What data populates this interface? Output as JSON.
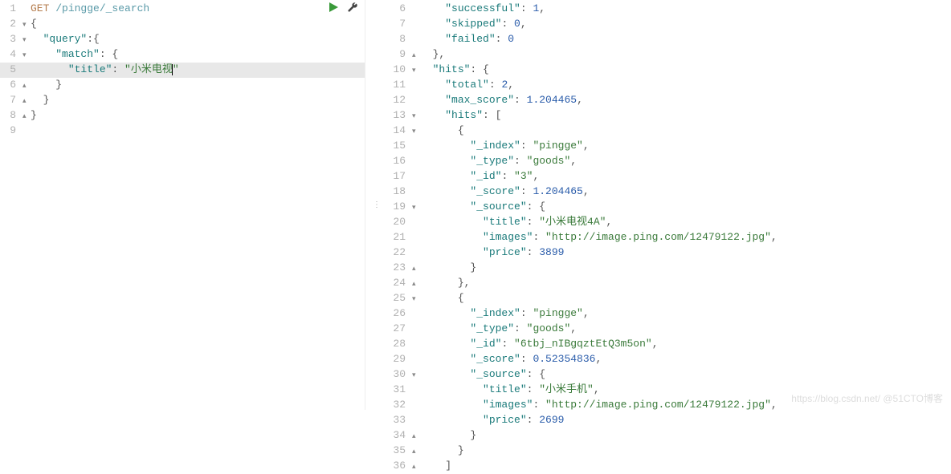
{
  "request": {
    "method": "GET",
    "path": "/pingge/_search",
    "lines": [
      {
        "n": 1,
        "fold": "",
        "indent": "",
        "segs": [
          [
            "kw-method",
            "GET"
          ],
          [
            "",
            ""
          ],
          [
            "path",
            "/pingge/_search"
          ]
        ]
      },
      {
        "n": 2,
        "fold": "▾",
        "indent": "",
        "segs": [
          [
            "punc",
            "{"
          ]
        ]
      },
      {
        "n": 3,
        "fold": "▾",
        "indent": "  ",
        "segs": [
          [
            "key",
            "\"query\""
          ],
          [
            "punc",
            ":{"
          ]
        ]
      },
      {
        "n": 4,
        "fold": "▾",
        "indent": "    ",
        "segs": [
          [
            "key",
            "\"match\""
          ],
          [
            "punc",
            ": {"
          ]
        ]
      },
      {
        "n": 5,
        "fold": "",
        "hl": true,
        "indent": "      ",
        "segs": [
          [
            "key",
            "\"title\""
          ],
          [
            "punc",
            ": "
          ],
          [
            "str",
            "\"小米电视"
          ],
          [
            "cursor",
            ""
          ],
          [
            "str",
            "\""
          ]
        ]
      },
      {
        "n": 6,
        "fold": "▴",
        "indent": "    ",
        "segs": [
          [
            "punc",
            "}"
          ]
        ]
      },
      {
        "n": 7,
        "fold": "▴",
        "indent": "  ",
        "segs": [
          [
            "punc",
            "}"
          ]
        ]
      },
      {
        "n": 8,
        "fold": "▴",
        "indent": "",
        "segs": [
          [
            "punc",
            "}"
          ]
        ]
      },
      {
        "n": 9,
        "fold": "",
        "indent": "",
        "segs": []
      }
    ]
  },
  "response": {
    "lines": [
      {
        "n": 6,
        "fold": "",
        "indent": "    ",
        "segs": [
          [
            "key",
            "\"successful\""
          ],
          [
            "punc",
            ": "
          ],
          [
            "num",
            "1"
          ],
          [
            "punc",
            ","
          ]
        ]
      },
      {
        "n": 7,
        "fold": "",
        "indent": "    ",
        "segs": [
          [
            "key",
            "\"skipped\""
          ],
          [
            "punc",
            ": "
          ],
          [
            "num",
            "0"
          ],
          [
            "punc",
            ","
          ]
        ]
      },
      {
        "n": 8,
        "fold": "",
        "indent": "    ",
        "segs": [
          [
            "key",
            "\"failed\""
          ],
          [
            "punc",
            ": "
          ],
          [
            "num",
            "0"
          ]
        ]
      },
      {
        "n": 9,
        "fold": "▴",
        "indent": "  ",
        "segs": [
          [
            "punc",
            "},"
          ]
        ]
      },
      {
        "n": 10,
        "fold": "▾",
        "indent": "  ",
        "segs": [
          [
            "key",
            "\"hits\""
          ],
          [
            "punc",
            ": {"
          ]
        ]
      },
      {
        "n": 11,
        "fold": "",
        "indent": "    ",
        "segs": [
          [
            "key",
            "\"total\""
          ],
          [
            "punc",
            ": "
          ],
          [
            "num",
            "2"
          ],
          [
            "punc",
            ","
          ]
        ]
      },
      {
        "n": 12,
        "fold": "",
        "indent": "    ",
        "segs": [
          [
            "key",
            "\"max_score\""
          ],
          [
            "punc",
            ": "
          ],
          [
            "num",
            "1.204465"
          ],
          [
            "punc",
            ","
          ]
        ]
      },
      {
        "n": 13,
        "fold": "▾",
        "indent": "    ",
        "segs": [
          [
            "key",
            "\"hits\""
          ],
          [
            "punc",
            ": ["
          ]
        ]
      },
      {
        "n": 14,
        "fold": "▾",
        "indent": "      ",
        "segs": [
          [
            "punc",
            "{"
          ]
        ]
      },
      {
        "n": 15,
        "fold": "",
        "indent": "        ",
        "segs": [
          [
            "key",
            "\"_index\""
          ],
          [
            "punc",
            ": "
          ],
          [
            "str",
            "\"pingge\""
          ],
          [
            "punc",
            ","
          ]
        ]
      },
      {
        "n": 16,
        "fold": "",
        "indent": "        ",
        "segs": [
          [
            "key",
            "\"_type\""
          ],
          [
            "punc",
            ": "
          ],
          [
            "str",
            "\"goods\""
          ],
          [
            "punc",
            ","
          ]
        ]
      },
      {
        "n": 17,
        "fold": "",
        "indent": "        ",
        "segs": [
          [
            "key",
            "\"_id\""
          ],
          [
            "punc",
            ": "
          ],
          [
            "str",
            "\"3\""
          ],
          [
            "punc",
            ","
          ]
        ]
      },
      {
        "n": 18,
        "fold": "",
        "indent": "        ",
        "segs": [
          [
            "key",
            "\"_score\""
          ],
          [
            "punc",
            ": "
          ],
          [
            "num",
            "1.204465"
          ],
          [
            "punc",
            ","
          ]
        ]
      },
      {
        "n": 19,
        "fold": "▾",
        "indent": "        ",
        "segs": [
          [
            "key",
            "\"_source\""
          ],
          [
            "punc",
            ": {"
          ]
        ]
      },
      {
        "n": 20,
        "fold": "",
        "indent": "          ",
        "segs": [
          [
            "key",
            "\"title\""
          ],
          [
            "punc",
            ": "
          ],
          [
            "str",
            "\"小米电视4A\""
          ],
          [
            "punc",
            ","
          ]
        ]
      },
      {
        "n": 21,
        "fold": "",
        "indent": "          ",
        "segs": [
          [
            "key",
            "\"images\""
          ],
          [
            "punc",
            ": "
          ],
          [
            "str",
            "\"http://image.ping.com/12479122.jpg\""
          ],
          [
            "punc",
            ","
          ]
        ]
      },
      {
        "n": 22,
        "fold": "",
        "indent": "          ",
        "segs": [
          [
            "key",
            "\"price\""
          ],
          [
            "punc",
            ": "
          ],
          [
            "num",
            "3899"
          ]
        ]
      },
      {
        "n": 23,
        "fold": "▴",
        "indent": "        ",
        "segs": [
          [
            "punc",
            "}"
          ]
        ]
      },
      {
        "n": 24,
        "fold": "▴",
        "indent": "      ",
        "segs": [
          [
            "punc",
            "},"
          ]
        ]
      },
      {
        "n": 25,
        "fold": "▾",
        "indent": "      ",
        "segs": [
          [
            "punc",
            "{"
          ]
        ]
      },
      {
        "n": 26,
        "fold": "",
        "indent": "        ",
        "segs": [
          [
            "key",
            "\"_index\""
          ],
          [
            "punc",
            ": "
          ],
          [
            "str",
            "\"pingge\""
          ],
          [
            "punc",
            ","
          ]
        ]
      },
      {
        "n": 27,
        "fold": "",
        "indent": "        ",
        "segs": [
          [
            "key",
            "\"_type\""
          ],
          [
            "punc",
            ": "
          ],
          [
            "str",
            "\"goods\""
          ],
          [
            "punc",
            ","
          ]
        ]
      },
      {
        "n": 28,
        "fold": "",
        "indent": "        ",
        "segs": [
          [
            "key",
            "\"_id\""
          ],
          [
            "punc",
            ": "
          ],
          [
            "str",
            "\"6tbj_nIBgqztEtQ3m5on\""
          ],
          [
            "punc",
            ","
          ]
        ]
      },
      {
        "n": 29,
        "fold": "",
        "indent": "        ",
        "segs": [
          [
            "key",
            "\"_score\""
          ],
          [
            "punc",
            ": "
          ],
          [
            "num",
            "0.52354836"
          ],
          [
            "punc",
            ","
          ]
        ]
      },
      {
        "n": 30,
        "fold": "▾",
        "indent": "        ",
        "segs": [
          [
            "key",
            "\"_source\""
          ],
          [
            "punc",
            ": {"
          ]
        ]
      },
      {
        "n": 31,
        "fold": "",
        "indent": "          ",
        "segs": [
          [
            "key",
            "\"title\""
          ],
          [
            "punc",
            ": "
          ],
          [
            "str",
            "\"小米手机\""
          ],
          [
            "punc",
            ","
          ]
        ]
      },
      {
        "n": 32,
        "fold": "",
        "indent": "          ",
        "segs": [
          [
            "key",
            "\"images\""
          ],
          [
            "punc",
            ": "
          ],
          [
            "str",
            "\"http://image.ping.com/12479122.jpg\""
          ],
          [
            "punc",
            ","
          ]
        ]
      },
      {
        "n": 33,
        "fold": "",
        "indent": "          ",
        "segs": [
          [
            "key",
            "\"price\""
          ],
          [
            "punc",
            ": "
          ],
          [
            "num",
            "2699"
          ]
        ]
      },
      {
        "n": 34,
        "fold": "▴",
        "indent": "        ",
        "segs": [
          [
            "punc",
            "}"
          ]
        ]
      },
      {
        "n": 35,
        "fold": "▴",
        "indent": "      ",
        "segs": [
          [
            "punc",
            "}"
          ]
        ]
      },
      {
        "n": 36,
        "fold": "▴",
        "indent": "    ",
        "segs": [
          [
            "punc",
            "]"
          ]
        ]
      }
    ]
  },
  "watermark": "https://blog.csdn.net/  @51CTO博客"
}
